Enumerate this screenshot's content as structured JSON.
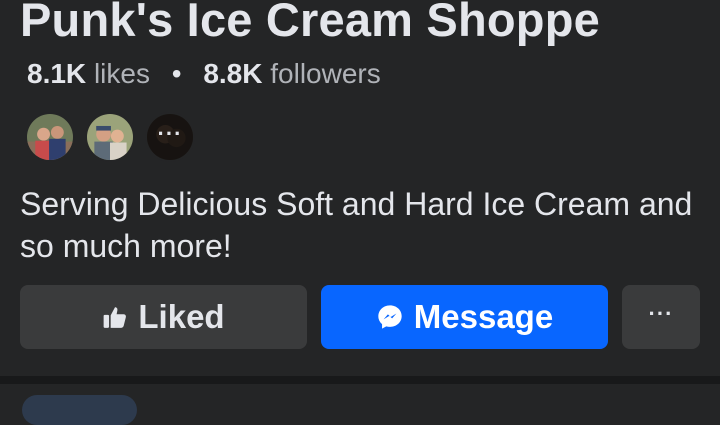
{
  "page": {
    "title": "Punk's Ice Cream Shoppe",
    "likes_count": "8.1K",
    "likes_label": "likes",
    "separator": "•",
    "followers_count": "8.8K",
    "followers_label": "followers",
    "bio": "Serving Delicious Soft and Hard Ice Cream and so much more!"
  },
  "friends": {
    "more_label": "···"
  },
  "actions": {
    "liked_label": "Liked",
    "message_label": "Message",
    "more_label": "···"
  },
  "colors": {
    "background": "#242526",
    "primary_button": "#0866ff",
    "secondary_button": "#3a3b3c"
  }
}
